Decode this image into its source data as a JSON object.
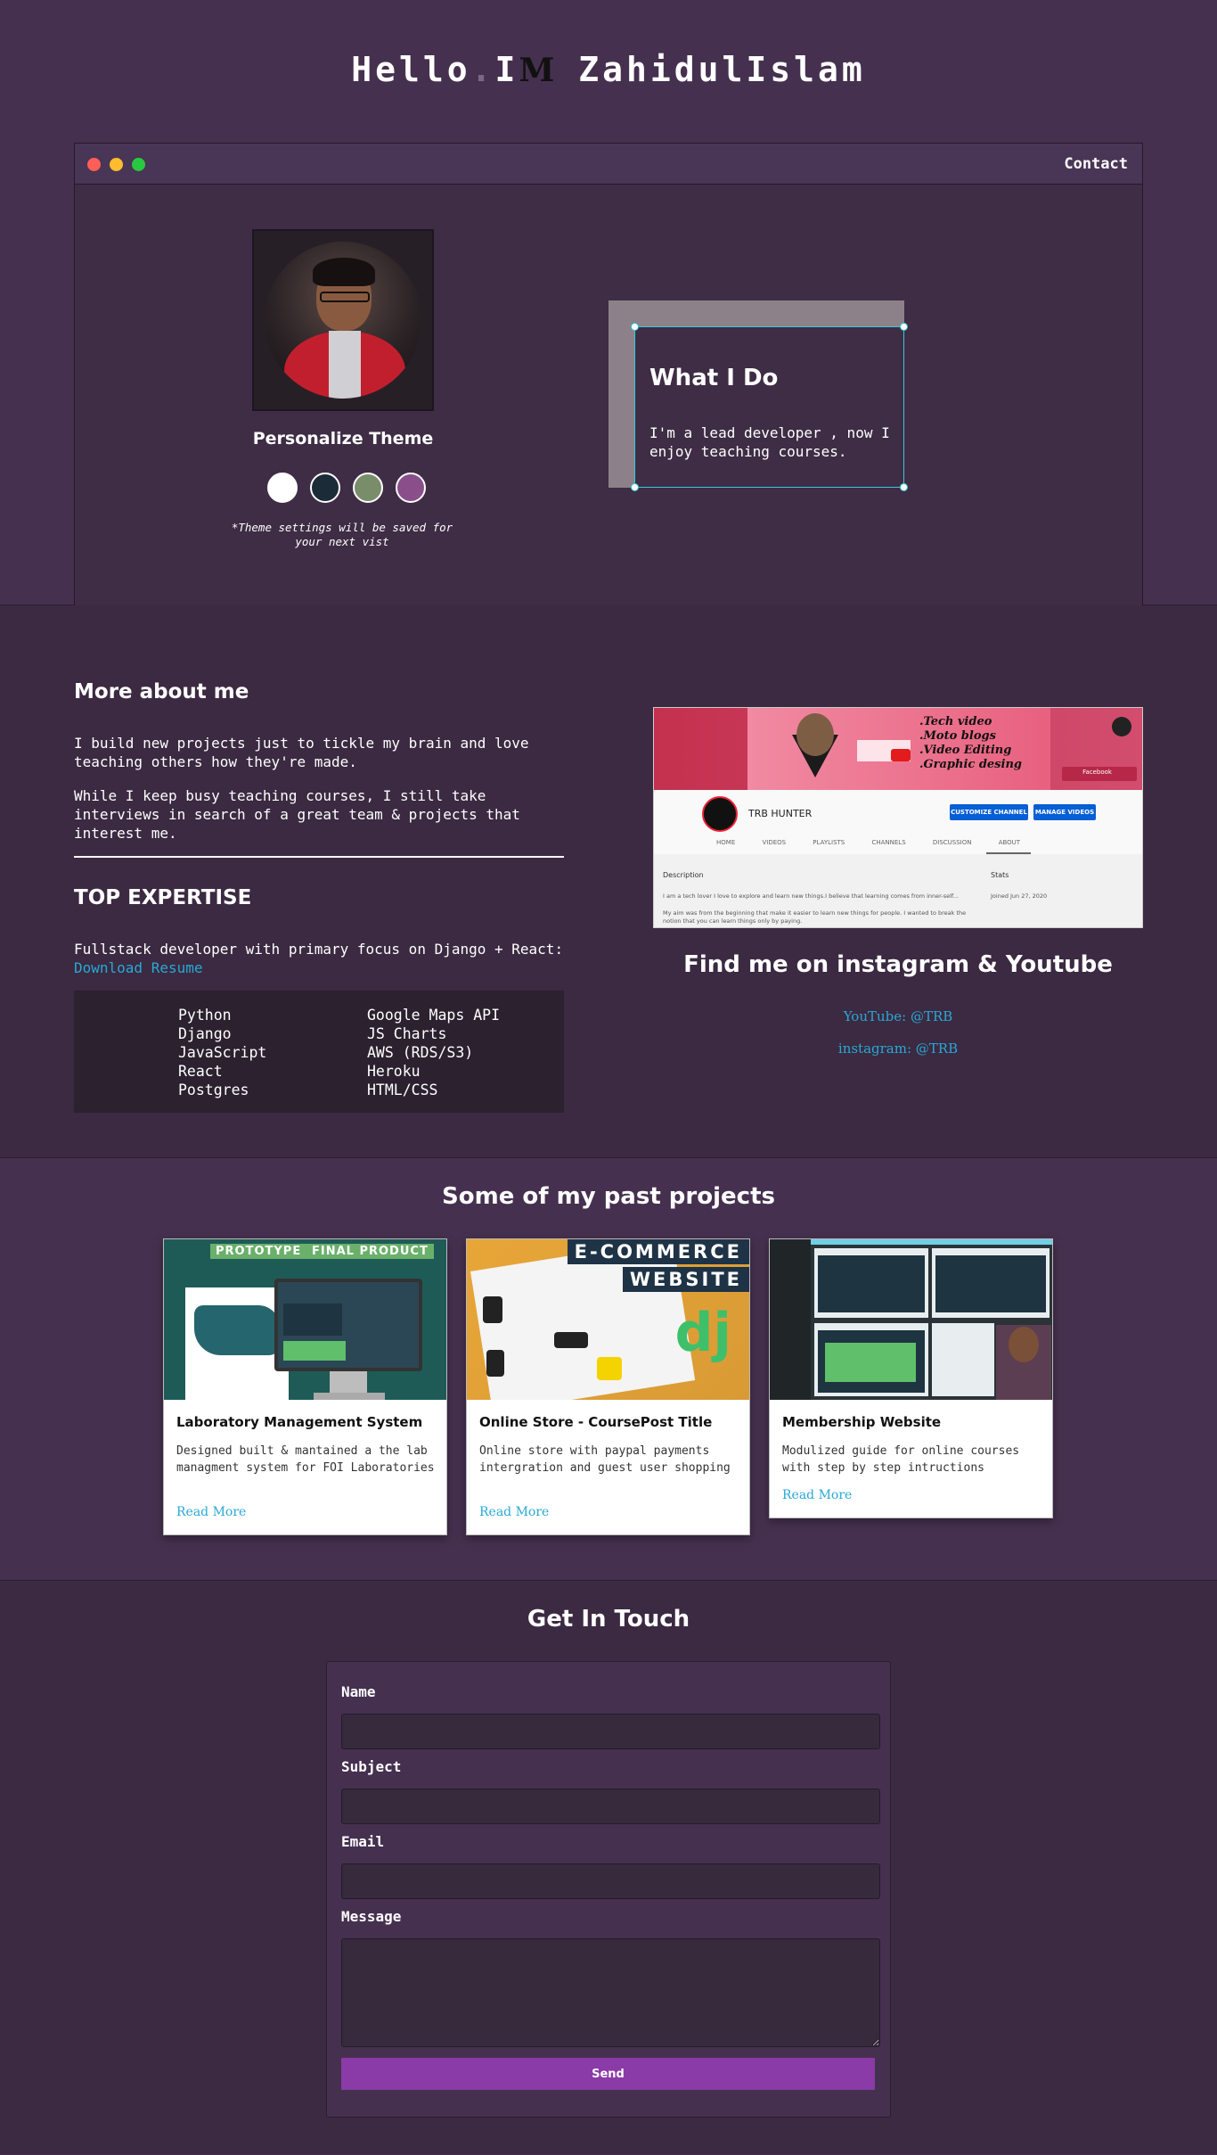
{
  "hero": {
    "title_hello": "Hello",
    "title_dot": ".",
    "title_i": "I",
    "title_m": "M",
    "title_name": "ZahidulIslam"
  },
  "window": {
    "contact_label": "Contact"
  },
  "theme": {
    "title": "Personalize Theme",
    "swatches": [
      "#ffffff",
      "#1b2b38",
      "#7a8d6a",
      "#8a4f8a"
    ],
    "note": "*Theme settings will be saved for your next vist"
  },
  "what_i_do": {
    "title": "What I Do",
    "text": "I'm a lead developer , now I enjoy teaching courses."
  },
  "about": {
    "heading": "More about me",
    "p1": "I build new projects just to tickle my brain and love teaching others how they're made.",
    "p2": "While I keep busy teaching courses, I still take interviews in search of a great team & projects that interest me."
  },
  "expertise": {
    "heading": "TOP EXPERTISE",
    "line": "Fullstack developer with primary focus on Django + React:",
    "resume_link": "Download Resume",
    "col1": [
      "Python",
      "Django",
      "JavaScript",
      "React",
      "Postgres"
    ],
    "col2": [
      "Google Maps API",
      "JS Charts",
      "AWS (RDS/S3)",
      "Heroku",
      "HTML/CSS"
    ]
  },
  "youtube_shot": {
    "banner_lines": [
      ".Tech video",
      ".Moto blogs",
      ".Video Editing",
      ".Graphic desing"
    ],
    "channel": "TRB HUNTER",
    "btn_customize": "CUSTOMIZE CHANNEL",
    "btn_manage": "MANAGE VIDEOS",
    "tabs": "HOME VIDEOS PLAYLISTS CHANNELS DISCUSSION ABOUT",
    "desc_label": "Description",
    "stats_label": "Stats",
    "desc_line1": "I am a tech lover I love to explore and learn new things.I believe that learning comes from inner-self...",
    "desc_line2": "My aim was from the beginning that make it easier to learn new things for people. I wanted to break the",
    "desc_line3": "notion that you can learn things only by paying.",
    "joined": "Joined Jun 27, 2020",
    "social_label": "Facebook"
  },
  "find_me": {
    "heading": "Find me on instagram & Youtube",
    "youtube": "YouTube: @TRB",
    "instagram": "instagram: @TRB"
  },
  "projects": {
    "heading": "Some of my past projects",
    "items": [
      {
        "title": "Laboratory Management System",
        "desc": "Designed built & mantained a the lab managment system for FOI Laboratories",
        "link": "Read More",
        "tags": [
          "PROTOTYPE",
          "FINAL PRODUCT"
        ]
      },
      {
        "title": "Online Store - CoursePost Title",
        "desc": "Online store with paypal payments intergration and guest user shopping",
        "link": "Read More",
        "tags": [
          "E-COMMERCE",
          "WEBSITE",
          "dj"
        ]
      },
      {
        "title": "Membership Website",
        "desc": "Modulized guide for online courses with step by step intructions",
        "link": "Read More"
      }
    ]
  },
  "contact_form": {
    "heading": "Get In Touch",
    "name_label": "Name",
    "subject_label": "Subject",
    "email_label": "Email",
    "message_label": "Message",
    "name_value": "",
    "subject_value": "",
    "email_value": "",
    "message_value": "",
    "send_label": "Send"
  }
}
